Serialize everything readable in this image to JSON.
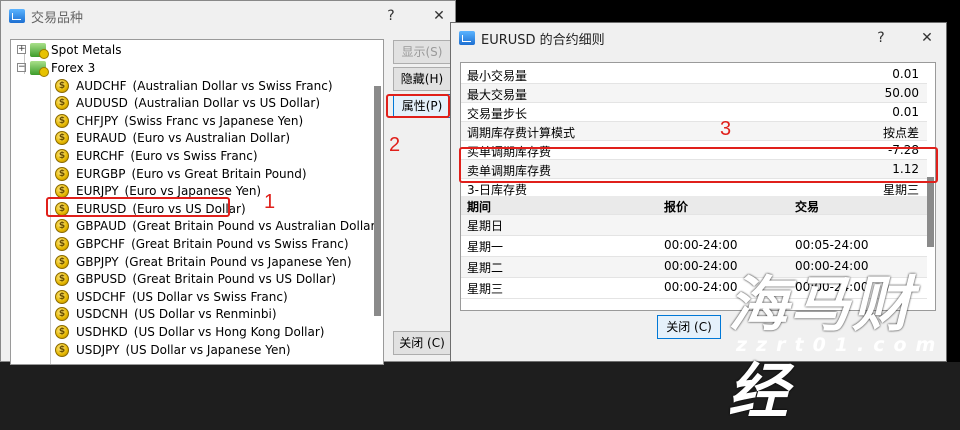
{
  "symbols_dialog": {
    "title": "交易品种",
    "help": "?",
    "close": "✕",
    "tree": [
      {
        "label": "Spot Metals"
      },
      {
        "label": "Forex 3"
      }
    ],
    "symbols": [
      {
        "code": "AUDCHF",
        "desc": "(Australian Dollar vs Swiss Franc)"
      },
      {
        "code": "AUDUSD",
        "desc": "(Australian Dollar vs US Dollar)"
      },
      {
        "code": "CHFJPY",
        "desc": "(Swiss Franc vs Japanese Yen)"
      },
      {
        "code": "EURAUD",
        "desc": "(Euro vs Australian Dollar)"
      },
      {
        "code": "EURCHF",
        "desc": "(Euro vs Swiss Franc)"
      },
      {
        "code": "EURGBP",
        "desc": "(Euro vs Great Britain Pound)"
      },
      {
        "code": "EURJPY",
        "desc": "(Euro vs Japanese Yen)"
      },
      {
        "code": "EURUSD",
        "desc": "(Euro vs US Dollar)"
      },
      {
        "code": "GBPAUD",
        "desc": "(Great Britain Pound vs Australian Dollar)"
      },
      {
        "code": "GBPCHF",
        "desc": "(Great Britain Pound vs Swiss Franc)"
      },
      {
        "code": "GBPJPY",
        "desc": "(Great Britain Pound vs Japanese Yen)"
      },
      {
        "code": "GBPUSD",
        "desc": "(Great Britain Pound vs US Dollar)"
      },
      {
        "code": "USDCHF",
        "desc": "(US Dollar vs Swiss Franc)"
      },
      {
        "code": "USDCNH",
        "desc": "(US Dollar vs Renminbi)"
      },
      {
        "code": "USDHKD",
        "desc": "(US Dollar vs Hong Kong Dollar)"
      },
      {
        "code": "USDJPY",
        "desc": "(US Dollar vs Japanese Yen)"
      }
    ],
    "buttons": {
      "show": "显示(S)",
      "hide": "隐藏(H)",
      "properties": "属性(P)",
      "close": "关闭 (C)"
    }
  },
  "spec_dialog": {
    "title": "EURUSD 的合约细则",
    "help": "?",
    "close": "✕",
    "rows": [
      {
        "k": "最小交易量",
        "v": "0.01"
      },
      {
        "k": "最大交易量",
        "v": "50.00"
      },
      {
        "k": "交易量步长",
        "v": "0.01"
      },
      {
        "k": "调期库存费计算模式",
        "v": "按点差"
      },
      {
        "k": "买单调期库存费",
        "v": "-7.28"
      },
      {
        "k": "卖单调期库存费",
        "v": "1.12"
      },
      {
        "k": "3-日库存费",
        "v": "星期三"
      }
    ],
    "session_header": {
      "c1": "期间",
      "c2": "报价",
      "c3": "交易"
    },
    "sessions": [
      {
        "day": "星期日",
        "quote": "",
        "trade": ""
      },
      {
        "day": "星期一",
        "quote": "00:00-24:00",
        "trade": "00:05-24:00"
      },
      {
        "day": "星期二",
        "quote": "00:00-24:00",
        "trade": "00:00-24:00"
      },
      {
        "day": "星期三",
        "quote": "00:00-24:00",
        "trade": "00:00-24:00"
      }
    ],
    "close_button": "关闭 (C)"
  },
  "annotations": {
    "n1": "1",
    "n2": "2",
    "n3": "3",
    "color": "#e0201b"
  },
  "watermark": {
    "main": "海马财经",
    "url": "zzrt01.com"
  }
}
